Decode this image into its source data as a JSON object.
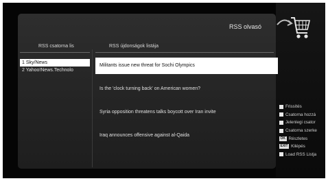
{
  "window": {
    "title": "RSS olvasó",
    "icon": "shopping-cart-icon"
  },
  "channels": {
    "header": "RSS csatorna lis",
    "items": [
      {
        "label": "1  Sky/News"
      },
      {
        "label": "2  Yahoo!News.Technolo"
      }
    ],
    "selected_index": 0
  },
  "news": {
    "header": "RSS újdonságok listája",
    "items": [
      {
        "label": "Militants issue new threat for Sochi Olympics"
      },
      {
        "label": "Is the 'clock turning back' on American women?"
      },
      {
        "label": "Syria opposition threatens talks boycott over Iran invite"
      },
      {
        "label": "Iraq announces offensive against al-Qaida"
      }
    ],
    "selected_index": 0
  },
  "legend": {
    "items": [
      {
        "label": "Frissítés",
        "key": "",
        "color": "#e8e8e8"
      },
      {
        "label": "Csatorna hozzá",
        "key": "",
        "color": "#e8e8e8"
      },
      {
        "label": "Jelenlegi csator",
        "key": "",
        "color": "#e8e8e8"
      },
      {
        "label": "Csatorna szerke",
        "key": "",
        "color": "#e8e8e8"
      },
      {
        "label": "Részletes",
        "key": "OK",
        "color": ""
      },
      {
        "label": "Kilépés",
        "key": "EXIT",
        "color": ""
      },
      {
        "label": "Load RSS Listja",
        "key": "",
        "color": "#e8e8e8"
      }
    ]
  }
}
